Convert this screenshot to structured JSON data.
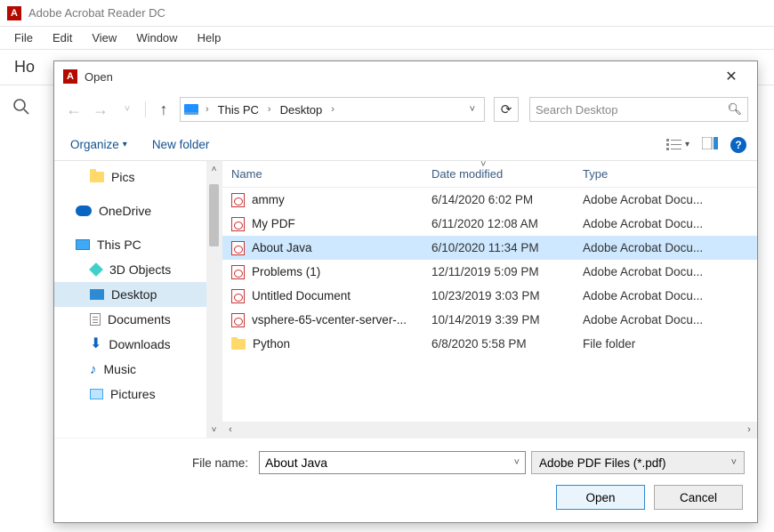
{
  "app": {
    "title": "Adobe Acrobat Reader DC"
  },
  "menubar": {
    "file": "File",
    "edit": "Edit",
    "view": "View",
    "window": "Window",
    "help": "Help"
  },
  "homebar": {
    "label": "Ho"
  },
  "dialog": {
    "title": "Open",
    "breadcrumb": {
      "root": "This PC",
      "folder": "Desktop"
    },
    "search_placeholder": "Search Desktop",
    "toolbar": {
      "organize": "Organize",
      "newfolder": "New folder"
    },
    "tree": {
      "pics": "Pics",
      "onedrive": "OneDrive",
      "thispc": "This PC",
      "objects3d": "3D Objects",
      "desktop": "Desktop",
      "documents": "Documents",
      "downloads": "Downloads",
      "music": "Music",
      "pictures": "Pictures"
    },
    "columns": {
      "name": "Name",
      "date": "Date modified",
      "type": "Type"
    },
    "files": [
      {
        "name": "ammy",
        "date": "6/14/2020 6:02 PM",
        "type": "Adobe Acrobat Docu...",
        "kind": "pdf"
      },
      {
        "name": "My PDF",
        "date": "6/11/2020 12:08 AM",
        "type": "Adobe Acrobat Docu...",
        "kind": "pdf"
      },
      {
        "name": "About Java",
        "date": "6/10/2020 11:34 PM",
        "type": "Adobe Acrobat Docu...",
        "kind": "pdf",
        "selected": true
      },
      {
        "name": "Problems (1)",
        "date": "12/11/2019 5:09 PM",
        "type": "Adobe Acrobat Docu...",
        "kind": "pdf"
      },
      {
        "name": "Untitled Document",
        "date": "10/23/2019 3:03 PM",
        "type": "Adobe Acrobat Docu...",
        "kind": "pdf"
      },
      {
        "name": "vsphere-65-vcenter-server-...",
        "date": "10/14/2019 3:39 PM",
        "type": "Adobe Acrobat Docu...",
        "kind": "pdf"
      },
      {
        "name": "Python",
        "date": "6/8/2020 5:58 PM",
        "type": "File folder",
        "kind": "folder"
      }
    ],
    "filename_label": "File name:",
    "filename_value": "About Java",
    "filetype_value": "Adobe PDF Files (*.pdf)",
    "open_btn": "Open",
    "cancel_btn": "Cancel"
  }
}
